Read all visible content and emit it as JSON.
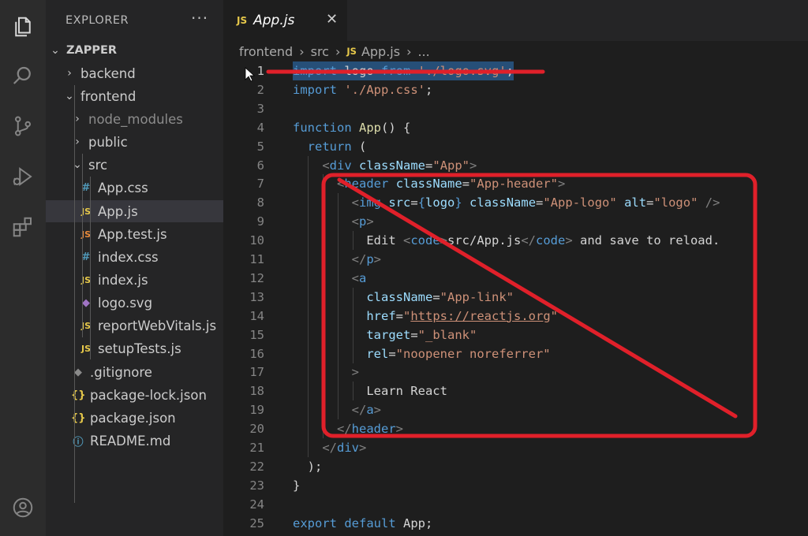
{
  "explorer": {
    "title": "EXPLORER",
    "more": "···",
    "tree": [
      {
        "label": "ZAPPER",
        "chev": "⌄",
        "indent": 0,
        "type": "root"
      },
      {
        "label": "backend",
        "chev": "›",
        "indent": 1,
        "type": "folder"
      },
      {
        "label": "frontend",
        "chev": "⌄",
        "indent": 1,
        "type": "folder"
      },
      {
        "label": "node_modules",
        "chev": "›",
        "indent": 2,
        "type": "folder-dim"
      },
      {
        "label": "public",
        "chev": "›",
        "indent": 2,
        "type": "folder"
      },
      {
        "label": "src",
        "chev": "⌄",
        "indent": 2,
        "type": "folder"
      },
      {
        "label": "App.css",
        "icon": "#",
        "indent": 3,
        "type": "css"
      },
      {
        "label": "App.js",
        "icon": "JS",
        "indent": 3,
        "type": "js",
        "selected": true
      },
      {
        "label": "App.test.js",
        "icon": "JS",
        "indent": 3,
        "type": "test"
      },
      {
        "label": "index.css",
        "icon": "#",
        "indent": 3,
        "type": "css"
      },
      {
        "label": "index.js",
        "icon": "JS",
        "indent": 3,
        "type": "js"
      },
      {
        "label": "logo.svg",
        "icon": "◆",
        "indent": 3,
        "type": "svg"
      },
      {
        "label": "reportWebVitals.js",
        "icon": "JS",
        "indent": 3,
        "type": "js"
      },
      {
        "label": "setupTests.js",
        "icon": "JS",
        "indent": 3,
        "type": "js"
      },
      {
        "label": ".gitignore",
        "icon": "◆",
        "indent": 2,
        "type": "git"
      },
      {
        "label": "package-lock.json",
        "icon": "{}",
        "indent": 2,
        "type": "json"
      },
      {
        "label": "package.json",
        "icon": "{}",
        "indent": 2,
        "type": "json"
      },
      {
        "label": "README.md",
        "icon": "ⓘ",
        "indent": 2,
        "type": "md"
      }
    ]
  },
  "tab": {
    "icon": "JS",
    "name": "App.js",
    "close": "✕"
  },
  "breadcrumb": {
    "parts": [
      "frontend",
      "src"
    ],
    "file_icon": "JS",
    "file": "App.js",
    "tail": "..."
  },
  "editor": {
    "current_line": 1,
    "lines": [
      [
        [
          "kw",
          "import"
        ],
        [
          "txt",
          " logo "
        ],
        [
          "kw",
          "from"
        ],
        [
          "txt",
          " "
        ],
        [
          "str",
          "'./logo.svg'"
        ],
        [
          "txt",
          ";"
        ]
      ],
      [
        [
          "kw",
          "import"
        ],
        [
          "txt",
          " "
        ],
        [
          "str",
          "'./App.css'"
        ],
        [
          "txt",
          ";"
        ]
      ],
      [],
      [
        [
          "kw",
          "function"
        ],
        [
          "txt",
          " "
        ],
        [
          "fn",
          "App"
        ],
        [
          "txt",
          "() {"
        ]
      ],
      [
        [
          "txt",
          "  "
        ],
        [
          "kw",
          "return"
        ],
        [
          "txt",
          " ("
        ]
      ],
      [
        [
          "txt",
          "    "
        ],
        [
          "pun",
          "<"
        ],
        [
          "tag",
          "div"
        ],
        [
          "txt",
          " "
        ],
        [
          "attr",
          "className"
        ],
        [
          "txt",
          "="
        ],
        [
          "str",
          "\"App\""
        ],
        [
          "pun",
          ">"
        ]
      ],
      [
        [
          "txt",
          "      "
        ],
        [
          "pun",
          "<"
        ],
        [
          "tag",
          "header"
        ],
        [
          "txt",
          " "
        ],
        [
          "attr",
          "className"
        ],
        [
          "txt",
          "="
        ],
        [
          "str",
          "\"App-header\""
        ],
        [
          "pun",
          ">"
        ]
      ],
      [
        [
          "txt",
          "        "
        ],
        [
          "pun",
          "<"
        ],
        [
          "tag",
          "img"
        ],
        [
          "txt",
          " "
        ],
        [
          "attr",
          "src"
        ],
        [
          "txt",
          "="
        ],
        [
          "kw",
          "{"
        ],
        [
          "attr",
          "logo"
        ],
        [
          "kw",
          "}"
        ],
        [
          "txt",
          " "
        ],
        [
          "attr",
          "className"
        ],
        [
          "txt",
          "="
        ],
        [
          "str",
          "\"App-logo\""
        ],
        [
          "txt",
          " "
        ],
        [
          "attr",
          "alt"
        ],
        [
          "txt",
          "="
        ],
        [
          "str",
          "\"logo\""
        ],
        [
          "txt",
          " "
        ],
        [
          "pun",
          "/>"
        ]
      ],
      [
        [
          "txt",
          "        "
        ],
        [
          "pun",
          "<"
        ],
        [
          "tag",
          "p"
        ],
        [
          "pun",
          ">"
        ]
      ],
      [
        [
          "txt",
          "          Edit "
        ],
        [
          "pun",
          "<"
        ],
        [
          "tag",
          "code"
        ],
        [
          "pun",
          ">"
        ],
        [
          "txt",
          "src/App.js"
        ],
        [
          "pun",
          "</"
        ],
        [
          "tag",
          "code"
        ],
        [
          "pun",
          ">"
        ],
        [
          "txt",
          " and save to reload."
        ]
      ],
      [
        [
          "txt",
          "        "
        ],
        [
          "pun",
          "</"
        ],
        [
          "tag",
          "p"
        ],
        [
          "pun",
          ">"
        ]
      ],
      [
        [
          "txt",
          "        "
        ],
        [
          "pun",
          "<"
        ],
        [
          "tag",
          "a"
        ]
      ],
      [
        [
          "txt",
          "          "
        ],
        [
          "attr",
          "className"
        ],
        [
          "txt",
          "="
        ],
        [
          "str",
          "\"App-link\""
        ]
      ],
      [
        [
          "txt",
          "          "
        ],
        [
          "attr",
          "href"
        ],
        [
          "txt",
          "="
        ],
        [
          "str",
          "\""
        ],
        [
          "url",
          "https://reactjs.org"
        ],
        [
          "str",
          "\""
        ]
      ],
      [
        [
          "txt",
          "          "
        ],
        [
          "attr",
          "target"
        ],
        [
          "txt",
          "="
        ],
        [
          "str",
          "\"_blank\""
        ]
      ],
      [
        [
          "txt",
          "          "
        ],
        [
          "attr",
          "rel"
        ],
        [
          "txt",
          "="
        ],
        [
          "str",
          "\"noopener noreferrer\""
        ]
      ],
      [
        [
          "txt",
          "        "
        ],
        [
          "pun",
          ">"
        ]
      ],
      [
        [
          "txt",
          "          Learn React"
        ]
      ],
      [
        [
          "txt",
          "        "
        ],
        [
          "pun",
          "</"
        ],
        [
          "tag",
          "a"
        ],
        [
          "pun",
          ">"
        ]
      ],
      [
        [
          "txt",
          "      "
        ],
        [
          "pun",
          "</"
        ],
        [
          "tag",
          "header"
        ],
        [
          "pun",
          ">"
        ]
      ],
      [
        [
          "txt",
          "    "
        ],
        [
          "pun",
          "</"
        ],
        [
          "tag",
          "div"
        ],
        [
          "pun",
          ">"
        ]
      ],
      [
        [
          "txt",
          "  );"
        ]
      ],
      [
        [
          "txt",
          "}"
        ]
      ],
      [],
      [
        [
          "kw",
          "export"
        ],
        [
          "txt",
          " "
        ],
        [
          "kw",
          "default"
        ],
        [
          "txt",
          " App;"
        ]
      ]
    ]
  },
  "annotation_color": "#e0202a",
  "colors": {
    "js": "#e6c84a",
    "test": "#e8893a",
    "css": "#519aba",
    "svg": "#a074c4",
    "json": "#e6c84a",
    "md": "#519aba",
    "git": "#8a8a8a"
  }
}
